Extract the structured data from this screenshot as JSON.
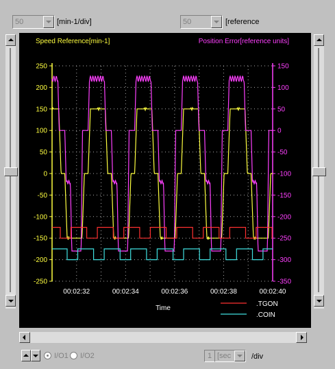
{
  "toolbar": {
    "left_scale_value": "50",
    "left_scale_unit": "[min-1/div]",
    "right_scale_value": "50",
    "right_scale_unit": "[reference"
  },
  "footer": {
    "radio_1_label": "I/O1",
    "radio_2_label": "I/O2",
    "time_value": "1",
    "time_unit": "[sec",
    "per_div_label": "/div"
  },
  "chart_data": {
    "type": "line",
    "title_left": "Speed Reference[min-1]",
    "title_right": "Position Error[reference units]",
    "xlabel": "Time",
    "xticks": [
      "00:02:32",
      "00:02:34",
      "00:02:36",
      "00:02:38",
      "00:02:40"
    ],
    "y_left": {
      "ylim": [
        -250,
        250
      ],
      "ticks": [
        250,
        200,
        150,
        100,
        50,
        0,
        -50,
        -100,
        -150,
        -200,
        -250
      ]
    },
    "y_right": {
      "ylim": [
        -350,
        150
      ],
      "ticks": [
        150,
        100,
        50,
        0,
        -50,
        -100,
        -150,
        -200,
        -250,
        -300,
        -350
      ]
    },
    "grid": true,
    "legend_placement": "bottom-right",
    "legend": [
      {
        "name": ".TGON",
        "color": "#ff3030"
      },
      {
        "name": ".COIN",
        "color": "#40e0e0"
      }
    ],
    "series": [
      {
        "name": "Speed Reference",
        "axis": "left",
        "color": "#ffff40",
        "period_div": 1.9,
        "start_div": -0.05,
        "levels": [
          150,
          0,
          -150,
          0
        ],
        "note": "trapezoid waveform between +150 and -150 min-1"
      },
      {
        "name": "Position Error",
        "axis": "right",
        "color": "#ff40ff",
        "levels": [
          130,
          0,
          -120,
          0
        ]
      },
      {
        "name": ".TGON",
        "color": "#ff3030",
        "digital_high": -125,
        "digital_low": -150
      },
      {
        "name": ".COIN",
        "color": "#40e0e0",
        "digital_high": -175,
        "digital_low": -200
      }
    ]
  },
  "colors": {
    "plot_background": "#000000",
    "grid": "#c0c0c0",
    "panel": "#c0c0c0"
  },
  "icons": {
    "scroll_up": "up-arrow-icon",
    "scroll_down": "down-arrow-icon",
    "scroll_left": "left-arrow-icon",
    "scroll_right": "right-arrow-icon",
    "dropdown": "chevron-down-icon"
  }
}
